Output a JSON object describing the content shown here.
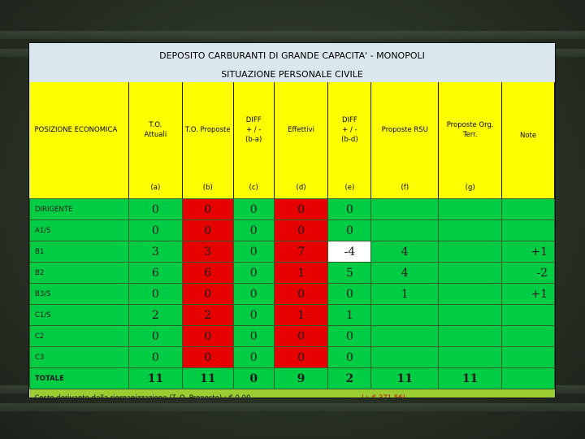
{
  "title": "DEPOSITO CARBURANTI DI GRANDE CAPACITA' - MONOPOLI",
  "subtitle": "SITUAZIONE PERSONALE CIVILE",
  "headers": {
    "pos": "POSIZIONE ECONOMICA",
    "cols": [
      [
        "T.O.",
        "Attuali"
      ],
      [
        "T.O. Proposte"
      ],
      [
        "DIFF",
        "+ / -",
        "(b-a)"
      ],
      [
        "Effettivi"
      ],
      [
        "DIFF",
        "+ / -",
        "(b-d)"
      ],
      [
        "Proposte RSU"
      ],
      [
        "Proposte Org.",
        "Terr."
      ],
      [
        "Note"
      ]
    ],
    "letters": [
      "(a)",
      "(b)",
      "(c)",
      "(d)",
      "(e)",
      "(f)",
      "(g)",
      ""
    ]
  },
  "rows": [
    {
      "pos": "DIRIGENTE",
      "a": "0",
      "b": "0",
      "c": "0",
      "d": "0",
      "e": "0",
      "f": "",
      "g": "",
      "note": ""
    },
    {
      "pos": "A1/S",
      "a": "0",
      "b": "0",
      "c": "0",
      "d": "0",
      "e": "0",
      "f": "",
      "g": "",
      "note": ""
    },
    {
      "pos": "B1",
      "a": "3",
      "b": "3",
      "c": "0",
      "d": "7",
      "e": "-4",
      "f": "4",
      "g": "",
      "note": "+1"
    },
    {
      "pos": "B2",
      "a": "6",
      "b": "6",
      "c": "0",
      "d": "1",
      "e": "5",
      "f": "4",
      "g": "",
      "note": "-2"
    },
    {
      "pos": "B3/S",
      "a": "0",
      "b": "0",
      "c": "0",
      "d": "0",
      "e": "0",
      "f": "1",
      "g": "",
      "note": "+1"
    },
    {
      "pos": "C1/S",
      "a": "2",
      "b": "2",
      "c": "0",
      "d": "1",
      "e": "1",
      "f": "",
      "g": "",
      "note": ""
    },
    {
      "pos": "C2",
      "a": "0",
      "b": "0",
      "c": "0",
      "d": "0",
      "e": "0",
      "f": "",
      "g": "",
      "note": ""
    },
    {
      "pos": "C3",
      "a": "0",
      "b": "0",
      "c": "0",
      "d": "0",
      "e": "0",
      "f": "",
      "g": "",
      "note": ""
    },
    {
      "pos": "TOTALE",
      "a": "11",
      "b": "11",
      "c": "0",
      "d": "9",
      "e": "2",
      "f": "11",
      "g": "11",
      "note": ""
    }
  ],
  "footer": {
    "text": "Costo derivante dalla riorganizzazione (T. O. Proposte) : € 0,00",
    "extra": "(+ € 371,56)"
  },
  "colors": {
    "title_bg": "#dbe7ee",
    "header": "#ffff00",
    "green": "#00cc44",
    "red": "#e60000",
    "footer": "#9acd32"
  }
}
